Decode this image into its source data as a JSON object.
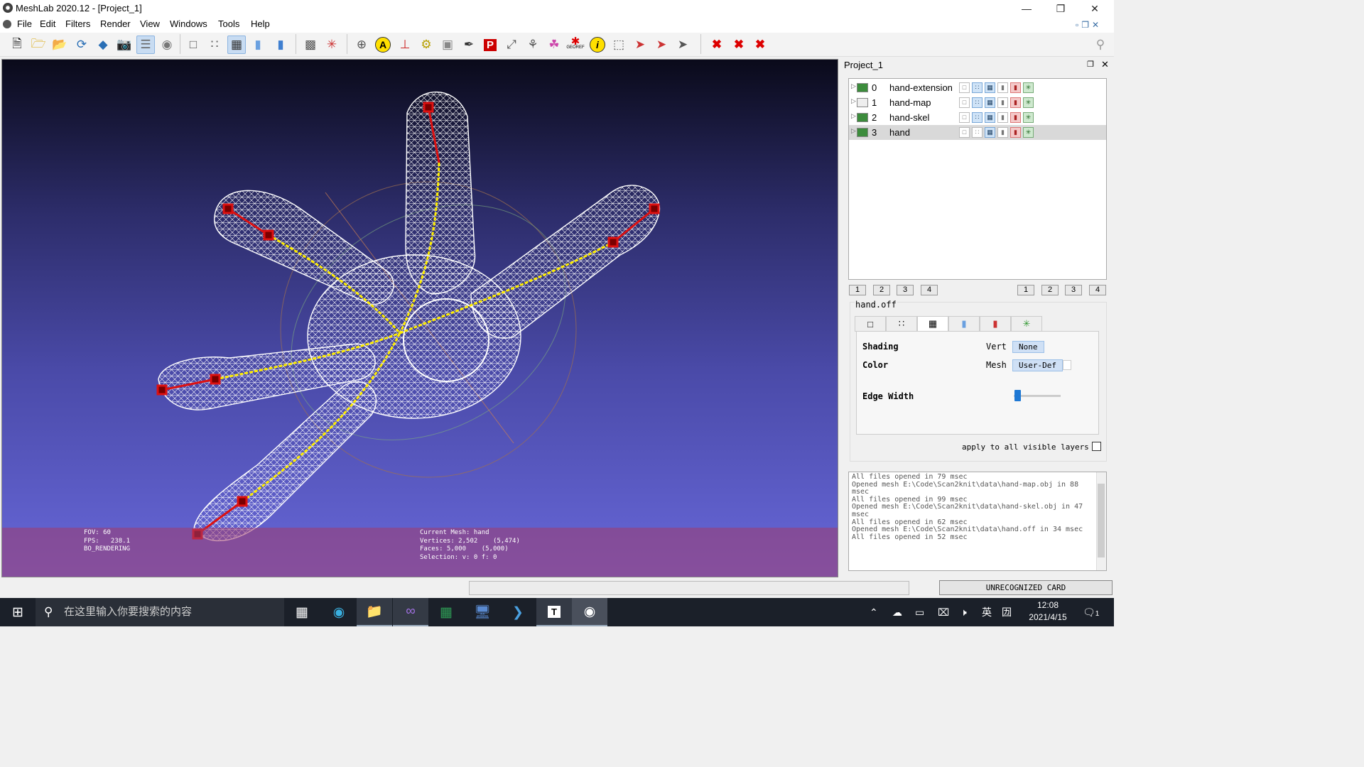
{
  "window": {
    "title": "MeshLab 2020.12 - [Project_1]",
    "min_icon": "minimize-icon",
    "max_icon": "restore-icon",
    "close_icon": "close-icon"
  },
  "menu": [
    "File",
    "Edit",
    "Filters",
    "Render",
    "View",
    "Windows",
    "Tools",
    "Help"
  ],
  "toolbar_icons": [
    "new-project-icon",
    "open-project-icon",
    "import-mesh-icon",
    "reload-icon",
    "export-mesh-icon",
    "snapshot-icon",
    "layers-icon",
    "raster-icon",
    "bbox-icon",
    "points-icon",
    "wireframe-icon",
    "flat-icon",
    "smooth-icon",
    "texture-icon",
    "lighting-icon",
    "trackball-icon",
    "annotation-icon",
    "axes-icon",
    "align-icon",
    "manipulator-icon",
    "paint-icon",
    "pickpoints-icon",
    "measure-icon",
    "select-vertices-icon",
    "georef-icon",
    "info-icon",
    "select-faces-icon",
    "select-connected-icon",
    "select-area-icon",
    "select-cursor-icon",
    "delete-vertices-icon",
    "delete-faces-icon",
    "delete-selection-icon"
  ],
  "toolbar_georef_label": "GEOREF",
  "viewport": {
    "left_info": [
      "FOV: 60",
      "FPS:   238.1",
      "BO_RENDERING"
    ],
    "mesh_info": [
      "Current Mesh: hand",
      "Vertices: 2,502    (5,474)",
      "Faces: 5,000    (5,000)",
      "Selection: v: 0 f: 0"
    ]
  },
  "panel": {
    "title": "Project_1",
    "layers": [
      {
        "index": "0",
        "name": "hand-extension",
        "visible": true
      },
      {
        "index": "1",
        "name": "hand-map",
        "visible": false
      },
      {
        "index": "2",
        "name": "hand-skel",
        "visible": true
      },
      {
        "index": "3",
        "name": "hand",
        "visible": true,
        "selected": true
      }
    ],
    "left_views": [
      "1",
      "2",
      "3",
      "4"
    ],
    "right_views": [
      "1",
      "2",
      "3",
      "4"
    ],
    "decorator_name": "hand.off",
    "render_tabs": [
      "bbox-icon",
      "points-icon",
      "wireframe-icon",
      "solid-icon",
      "texture-icon",
      "lighting-icon"
    ],
    "shading_label": "Shading",
    "shading_vert_label": "Vert",
    "shading_value": "None",
    "color_label": "Color",
    "color_mesh_label": "Mesh",
    "color_value": "User-Def",
    "edge_width_label": "Edge Width",
    "edge_width_level": 0.05,
    "apply_all_label": "apply to all visible layers"
  },
  "log": [
    "All files opened in 79 msec",
    "Opened mesh E:\\Code\\Scan2knit\\data\\hand-map.obj in 88 msec",
    "All files opened in 99 msec",
    "Opened mesh E:\\Code\\Scan2knit\\data\\hand-skel.obj in 47 msec",
    "All files opened in 62 msec",
    "Opened mesh E:\\Code\\Scan2knit\\data\\hand.off in 34 msec",
    "All files opened in 52 msec"
  ],
  "status": {
    "right": "UNRECOGNIZED CARD"
  },
  "taskbar": {
    "search_placeholder": "在这里输入你要搜索的内容",
    "apps": [
      "task-view-icon",
      "edge-icon",
      "file-explorer-icon",
      "visual-studio-icon",
      "excel-icon",
      "remote-desktop-icon",
      "powershell-icon",
      "typora-icon",
      "meshlab-icon"
    ],
    "typora_label": "T",
    "ime": "英",
    "ime2": "㘞",
    "time": "12:08",
    "date": "2021/4/15",
    "notification_count": "1"
  },
  "colors": {
    "viewport_top": "#0a0a1a",
    "viewport_bottom": "#6767d8",
    "skeleton": "#ffee00",
    "bone_red": "#dd1111"
  }
}
